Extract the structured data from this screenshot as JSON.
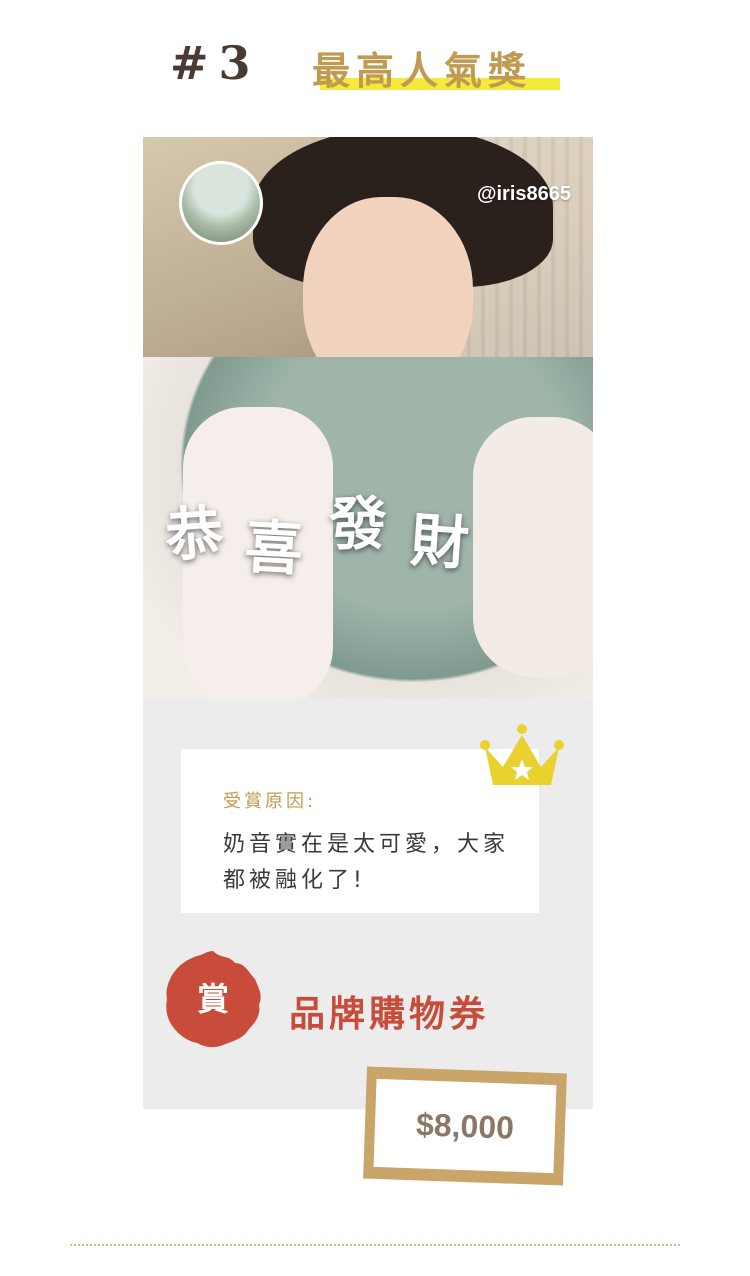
{
  "header": {
    "rank": "#3",
    "award_title": "最高人氣獎"
  },
  "photo": {
    "username": "@iris8665",
    "overlay_text": [
      "恭",
      "喜",
      "發",
      "財"
    ]
  },
  "reason": {
    "label": "受賞原因:",
    "text": "奶音實在是太可愛，大家都被融化了!"
  },
  "prize": {
    "badge_char": "賞",
    "name": "品牌購物券",
    "amount": "$8,000"
  },
  "colors": {
    "accent_gold": "#c19a52",
    "highlight_yellow": "#f3ea3d",
    "prize_red": "#c94b3a",
    "card_bg": "#ececec"
  },
  "icons": [
    "crown-icon",
    "avatar"
  ]
}
